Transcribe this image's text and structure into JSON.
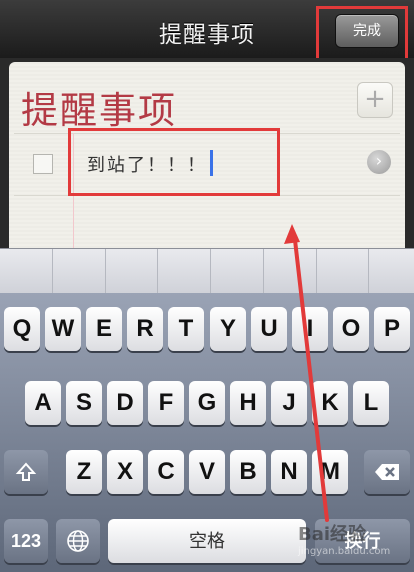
{
  "nav": {
    "title": "提醒事项",
    "done_label": "完成"
  },
  "list": {
    "title": "提醒事项",
    "add_label": "+"
  },
  "item": {
    "text": "到站了！！！",
    "detail_icon": "chevron-right-icon"
  },
  "keyboard": {
    "row1": [
      "Q",
      "W",
      "E",
      "R",
      "T",
      "Y",
      "U",
      "I",
      "O",
      "P"
    ],
    "row2": [
      "A",
      "S",
      "D",
      "F",
      "G",
      "H",
      "J",
      "K",
      "L"
    ],
    "row3": [
      "Z",
      "X",
      "C",
      "V",
      "B",
      "N",
      "M"
    ],
    "numbers_label": "123",
    "space_label": "空格",
    "return_label": "换行",
    "shift_icon": "shift-icon",
    "delete_icon": "delete-icon",
    "globe_icon": "globe-icon"
  },
  "watermark": {
    "text": "jingyan.baidu.com",
    "logo_text": "Bai经验"
  },
  "colors": {
    "annotation": "#e23a3a",
    "title": "#b33a45",
    "cursor": "#3a72e8"
  }
}
